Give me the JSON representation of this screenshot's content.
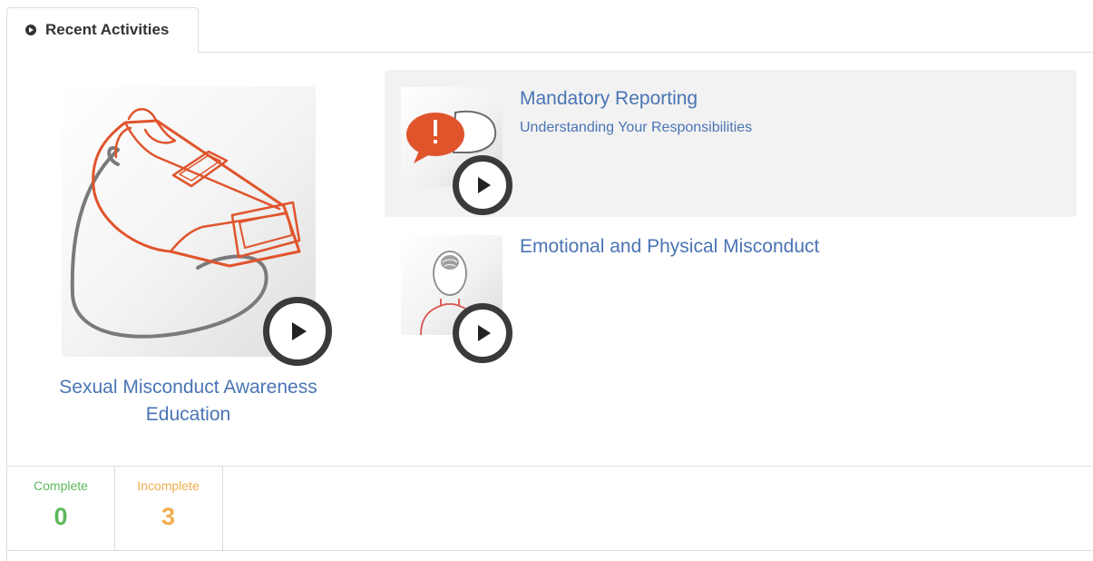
{
  "tab": {
    "label": "Recent Activities",
    "icon": "play-circle-icon"
  },
  "featured": {
    "title": "Sexual Misconduct Awareness Education",
    "thumbnail_icon": "whistle-icon"
  },
  "activities": [
    {
      "title": "Mandatory Reporting",
      "subtitle": "Understanding Your Responsibilities",
      "thumbnail_icon": "speech-bubble-alert-icon"
    },
    {
      "title": "Emotional and Physical Misconduct",
      "subtitle": "",
      "thumbnail_icon": "person-brain-icon"
    }
  ],
  "stats": [
    {
      "label": "Complete",
      "value": "0",
      "color": "#5cb85c"
    },
    {
      "label": "Incomplete",
      "value": "3",
      "color": "#f0ad4e"
    }
  ],
  "colors": {
    "link": "#4a74b4",
    "accent": "#e0542c"
  }
}
